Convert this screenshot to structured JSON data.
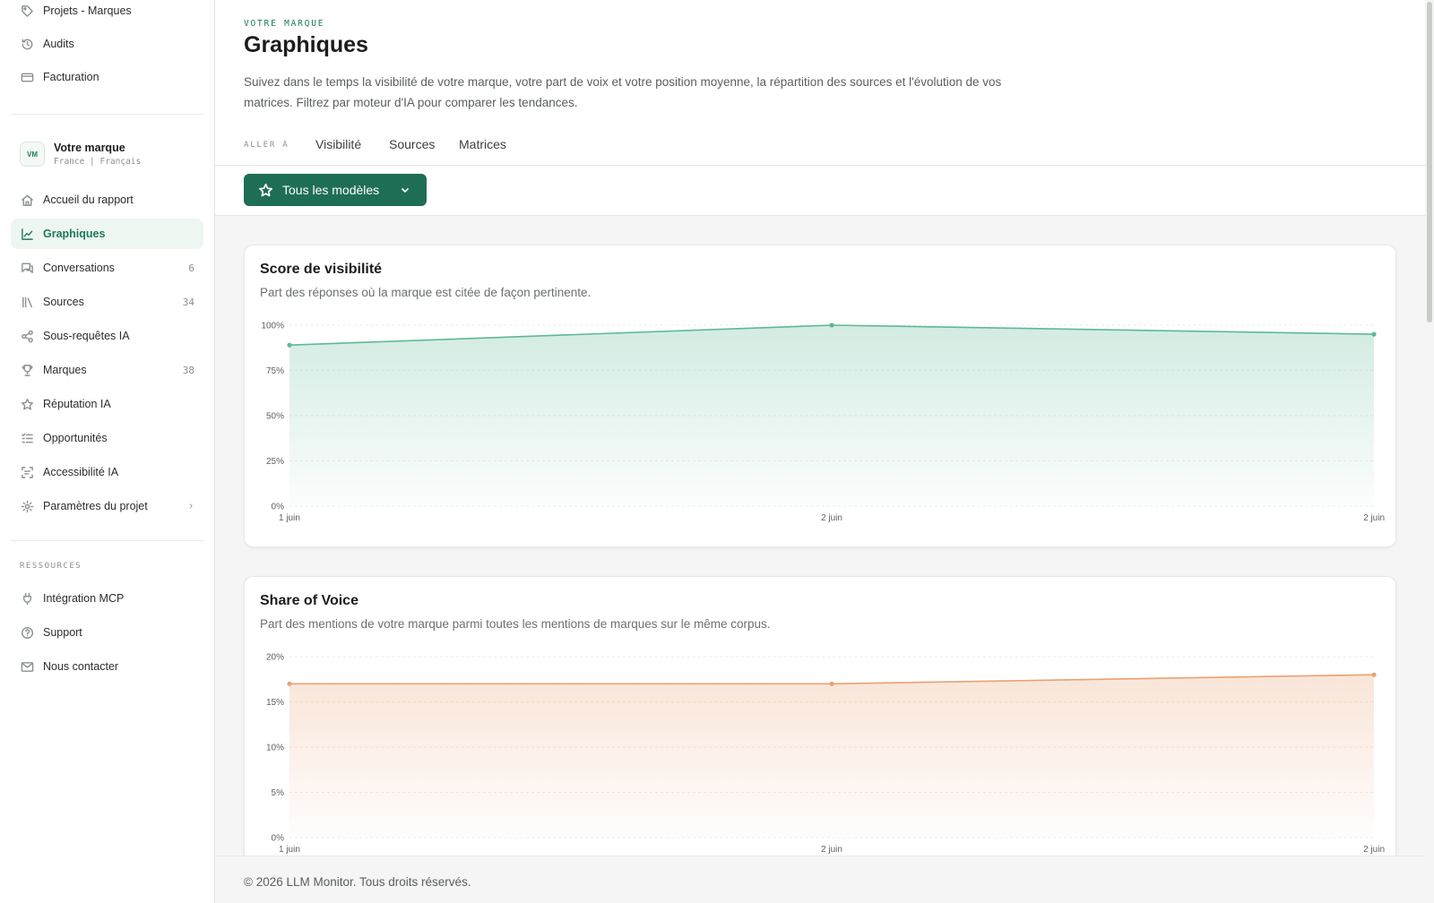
{
  "sidebar": {
    "top_items": [
      {
        "label": "Projets - Marques",
        "icon": "tag-icon"
      },
      {
        "label": "Audits",
        "icon": "history-icon"
      },
      {
        "label": "Facturation",
        "icon": "credit-card-icon"
      }
    ],
    "brand": {
      "initials": "VM",
      "name": "Votre marque",
      "meta": "France | Français"
    },
    "items": [
      {
        "label": "Accueil du rapport",
        "icon": "home-icon",
        "count": ""
      },
      {
        "label": "Graphiques",
        "icon": "chart-line-icon",
        "count": "",
        "active": true
      },
      {
        "label": "Conversations",
        "icon": "chat-icon",
        "count": "6"
      },
      {
        "label": "Sources",
        "icon": "library-icon",
        "count": "34"
      },
      {
        "label": "Sous-requêtes IA",
        "icon": "share-nodes-icon",
        "count": ""
      },
      {
        "label": "Marques",
        "icon": "trophy-icon",
        "count": "38"
      },
      {
        "label": "Réputation IA",
        "icon": "star-icon",
        "count": ""
      },
      {
        "label": "Opportunités",
        "icon": "checklist-icon",
        "count": ""
      },
      {
        "label": "Accessibilité IA",
        "icon": "scan-icon",
        "count": ""
      },
      {
        "label": "Paramètres du projet",
        "icon": "gear-icon",
        "count": ""
      }
    ],
    "resources_label": "RESSOURCES",
    "resources": [
      {
        "label": "Intégration MCP",
        "icon": "plug-icon"
      },
      {
        "label": "Support",
        "icon": "help-circle-icon"
      },
      {
        "label": "Nous contacter",
        "icon": "mail-icon"
      }
    ]
  },
  "header": {
    "eyebrow": "VOTRE MARQUE",
    "title": "Graphiques",
    "description": "Suivez dans le temps la visibilité de votre marque, votre part de voix et votre position moyenne, la répartition des sources et l'évolution de vos matrices. Filtrez par moteur d'IA pour comparer les tendances.",
    "goto_label": "ALLER À",
    "tabs": [
      "Visibilité",
      "Sources",
      "Matrices"
    ]
  },
  "filter": {
    "model_label": "Tous les modèles"
  },
  "colors": {
    "accent": "#1e6e55",
    "visibility_line": "#5fb896",
    "sov_line": "#e8a273"
  },
  "chart_data": [
    {
      "type": "area",
      "title": "Score de visibilité",
      "subtitle": "Part des réponses où la marque est citée de façon pertinente.",
      "x": [
        "1 juin",
        "2 juin",
        "2 juin"
      ],
      "values": [
        89,
        100,
        95
      ],
      "ylim": [
        0,
        100
      ],
      "yticks": [
        "0%",
        "25%",
        "50%",
        "75%",
        "100%"
      ],
      "grid": true
    },
    {
      "type": "area",
      "title": "Share of Voice",
      "subtitle": "Part des mentions de votre marque parmi toutes les mentions de marques sur le même corpus.",
      "x": [
        "1 juin",
        "2 juin",
        "2 juin"
      ],
      "values": [
        17,
        17,
        18
      ],
      "ylim": [
        0,
        20
      ],
      "yticks": [
        "0%",
        "5%",
        "10%",
        "15%",
        "20%"
      ],
      "grid": true
    }
  ],
  "footer": {
    "text": "© 2026 LLM Monitor. Tous droits réservés."
  }
}
